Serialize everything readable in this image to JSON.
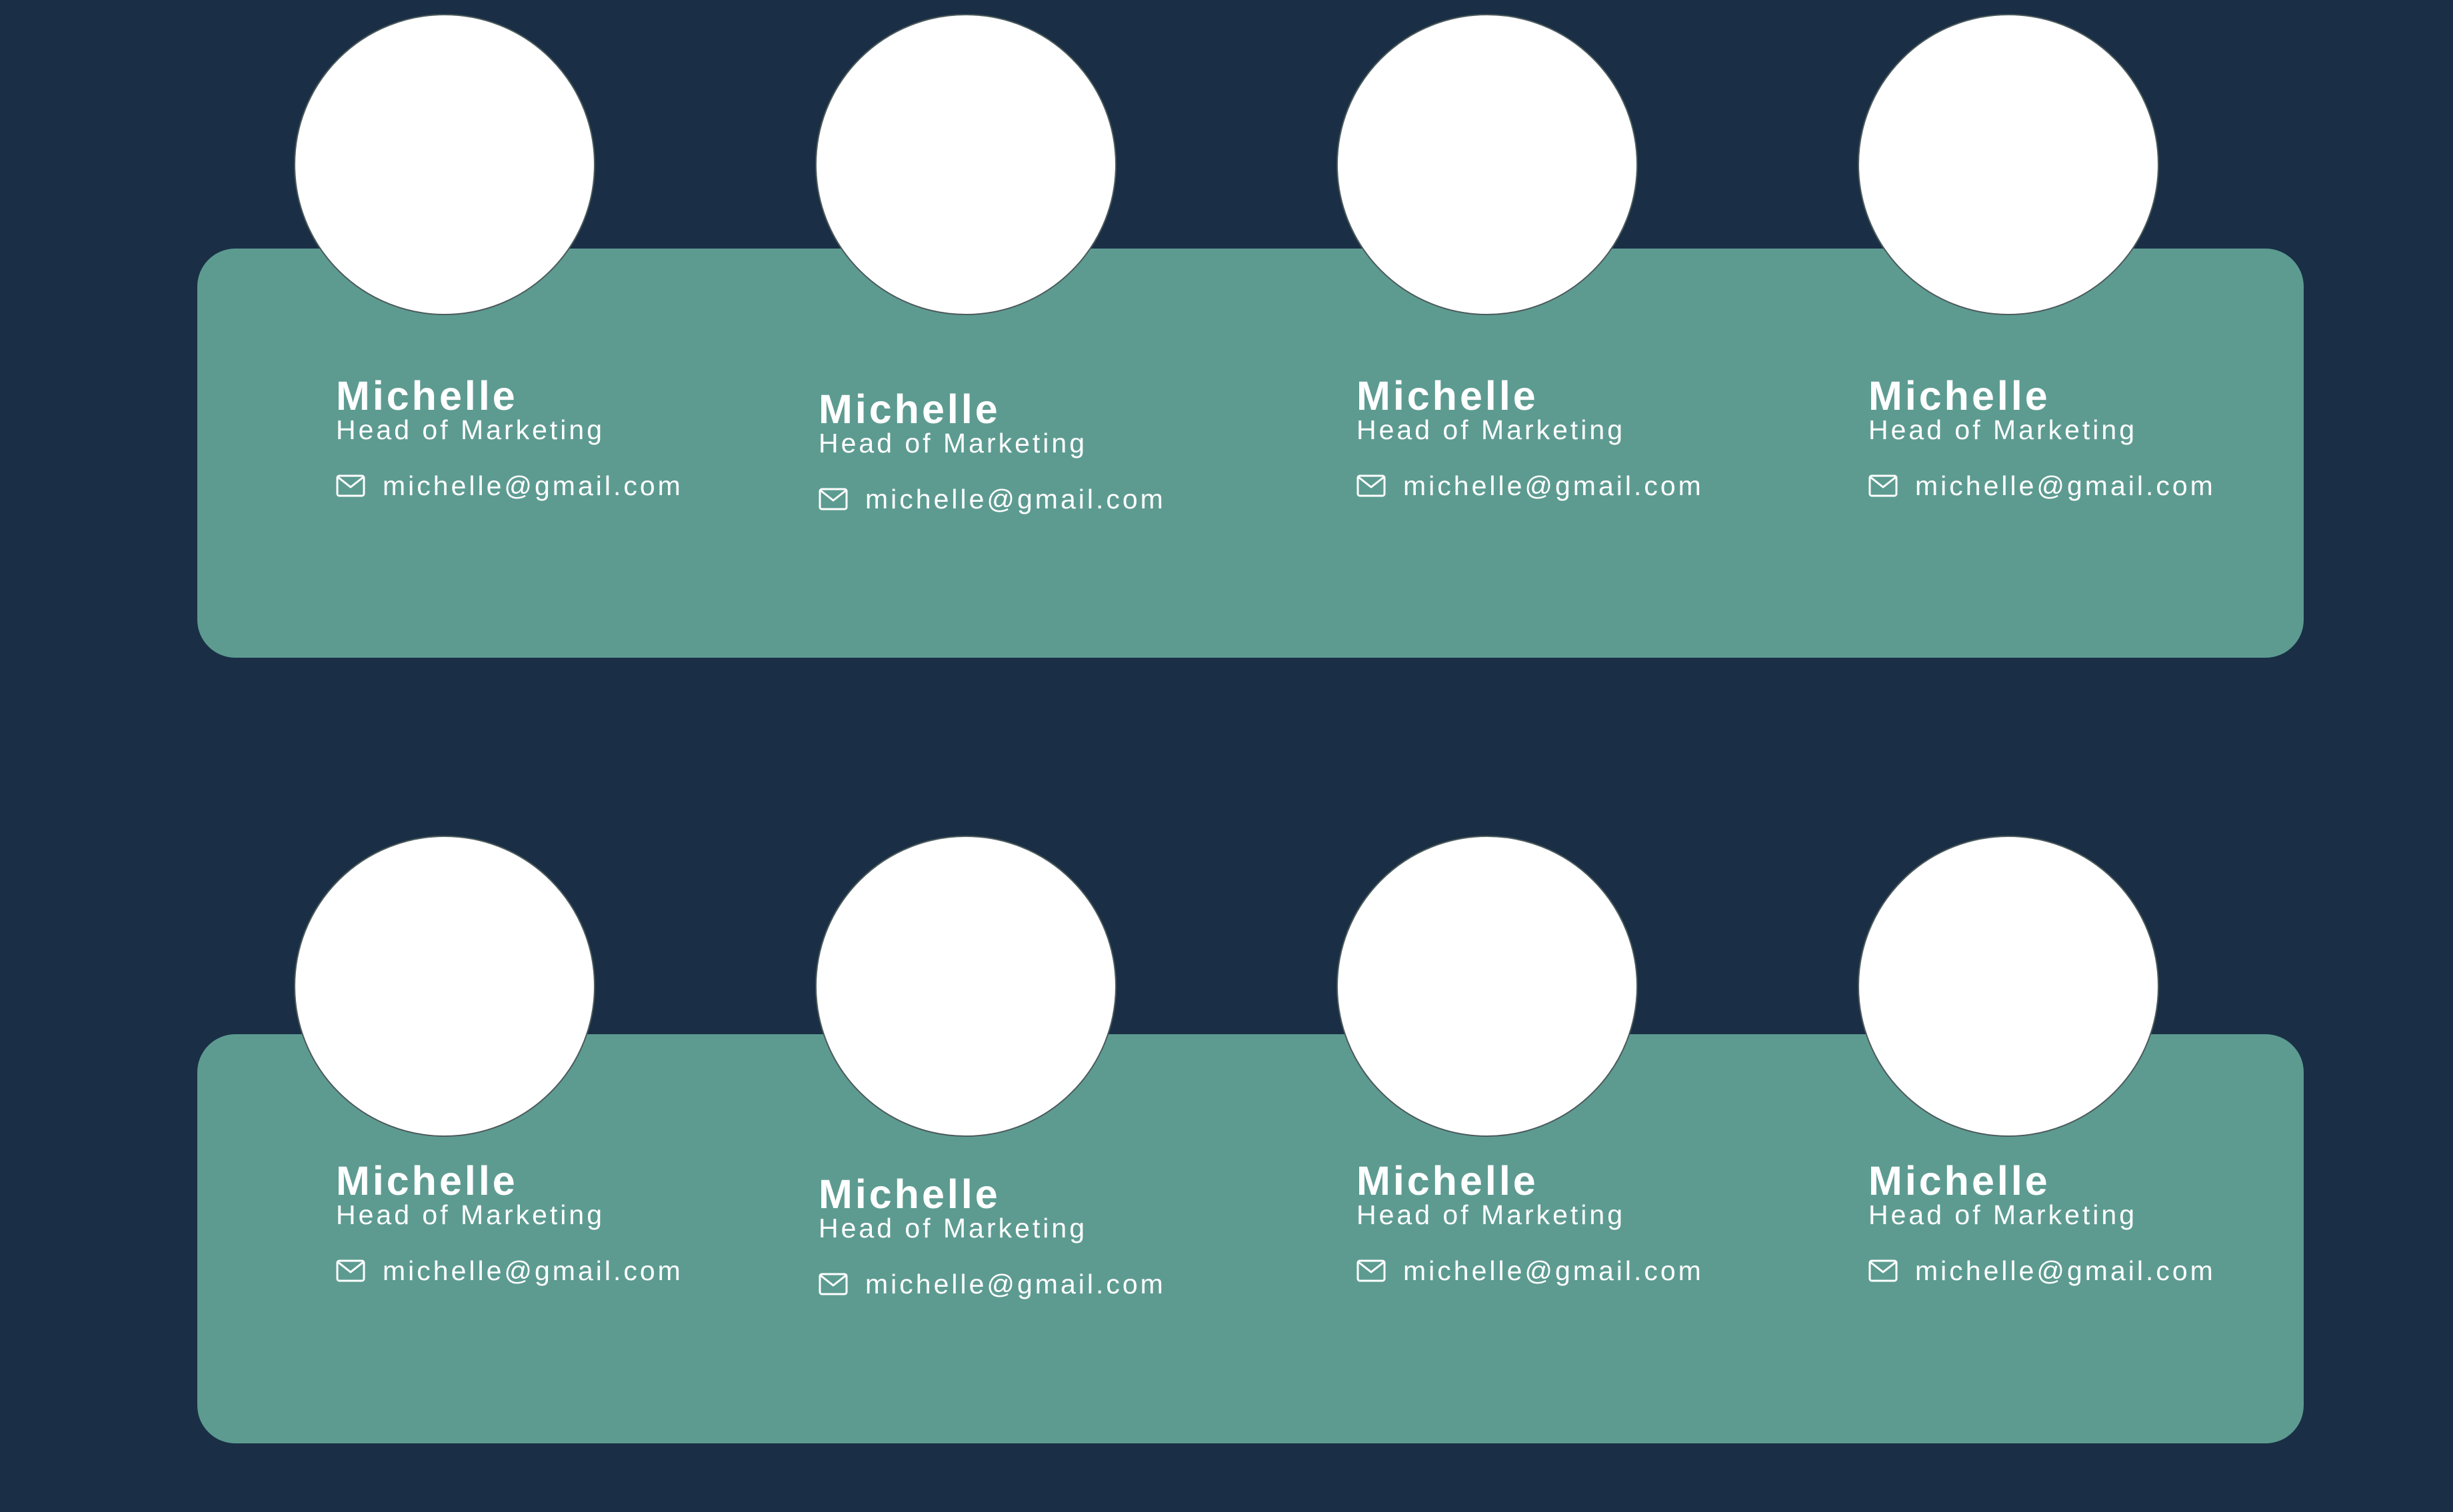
{
  "palette": {
    "background": "#1a2f45",
    "band": "#5d9b91",
    "avatar": "#ffffff",
    "text": "#ffffff"
  },
  "rows": [
    {
      "members": [
        {
          "name": "Michelle",
          "role": "Head of Marketing",
          "email": "michelle@gmail.com",
          "icon": "mail-icon"
        },
        {
          "name": "Michelle",
          "role": "Head of Marketing",
          "email": "michelle@gmail.com",
          "icon": "mail-icon"
        },
        {
          "name": "Michelle",
          "role": "Head of Marketing",
          "email": "michelle@gmail.com",
          "icon": "mail-icon"
        },
        {
          "name": "Michelle",
          "role": "Head of Marketing",
          "email": "michelle@gmail.com",
          "icon": "mail-icon"
        }
      ]
    },
    {
      "members": [
        {
          "name": "Michelle",
          "role": "Head of Marketing",
          "email": "michelle@gmail.com",
          "icon": "mail-icon"
        },
        {
          "name": "Michelle",
          "role": "Head of Marketing",
          "email": "michelle@gmail.com",
          "icon": "mail-icon"
        },
        {
          "name": "Michelle",
          "role": "Head of Marketing",
          "email": "michelle@gmail.com",
          "icon": "mail-icon"
        },
        {
          "name": "Michelle",
          "role": "Head of Marketing",
          "email": "michelle@gmail.com",
          "icon": "mail-icon"
        }
      ]
    }
  ]
}
